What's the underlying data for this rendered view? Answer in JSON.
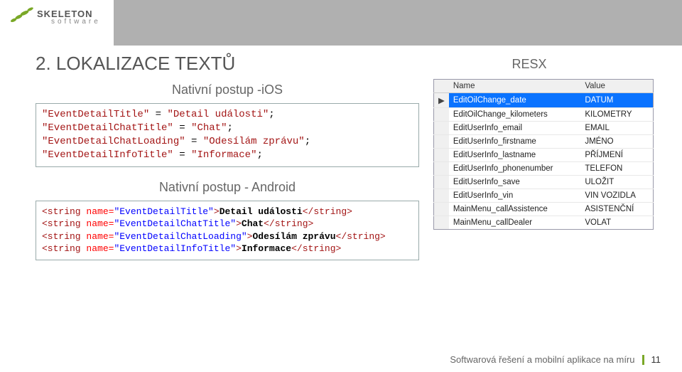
{
  "brand": {
    "name": "SKELETON",
    "sub": "software"
  },
  "title": "2. LOKALIZACE TEXTŮ",
  "ios": {
    "heading": "Nativní postup -iOS",
    "lines": [
      {
        "key": "\"EventDetailTitle\"",
        "val": "\"Detail události\""
      },
      {
        "key": "\"EventDetailChatTitle\"",
        "val": "\"Chat\""
      },
      {
        "key": "\"EventDetailChatLoading\"",
        "val": "\"Odesílám zprávu\""
      },
      {
        "key": "\"EventDetailInfoTitle\"",
        "val": "\"Informace\""
      }
    ]
  },
  "android": {
    "heading": "Nativní postup - Android",
    "lines": [
      {
        "name": "EventDetailTitle",
        "text": "Detail události"
      },
      {
        "name": "EventDetailChatTitle",
        "text": "Chat"
      },
      {
        "name": "EventDetailChatLoading",
        "text": "Odesílám zprávu"
      },
      {
        "name": "EventDetailInfoTitle",
        "text": "Informace"
      }
    ]
  },
  "resx": {
    "heading": "RESX",
    "cols": {
      "name": "Name",
      "value": "Value"
    },
    "rows": [
      {
        "name": "EditOilChange_date",
        "value": "DATUM",
        "selected": true
      },
      {
        "name": "EditOilChange_kilometers",
        "value": "KILOMETRY",
        "selected": false
      },
      {
        "name": "EditUserInfo_email",
        "value": "EMAIL",
        "selected": false
      },
      {
        "name": "EditUserInfo_firstname",
        "value": "JMÉNO",
        "selected": false
      },
      {
        "name": "EditUserInfo_lastname",
        "value": "PŘÍJMENÍ",
        "selected": false
      },
      {
        "name": "EditUserInfo_phonenumber",
        "value": "TELEFON",
        "selected": false
      },
      {
        "name": "EditUserInfo_save",
        "value": "ULOŽIT",
        "selected": false
      },
      {
        "name": "EditUserInfo_vin",
        "value": "VIN VOZIDLA",
        "selected": false
      },
      {
        "name": "MainMenu_callAssistence",
        "value": "ASISTENČNÍ",
        "selected": false
      },
      {
        "name": "MainMenu_callDealer",
        "value": "VOLAT",
        "selected": false
      }
    ]
  },
  "footer": {
    "text": "Softwarová řešení a mobilní aplikace na míru",
    "page": "11"
  }
}
